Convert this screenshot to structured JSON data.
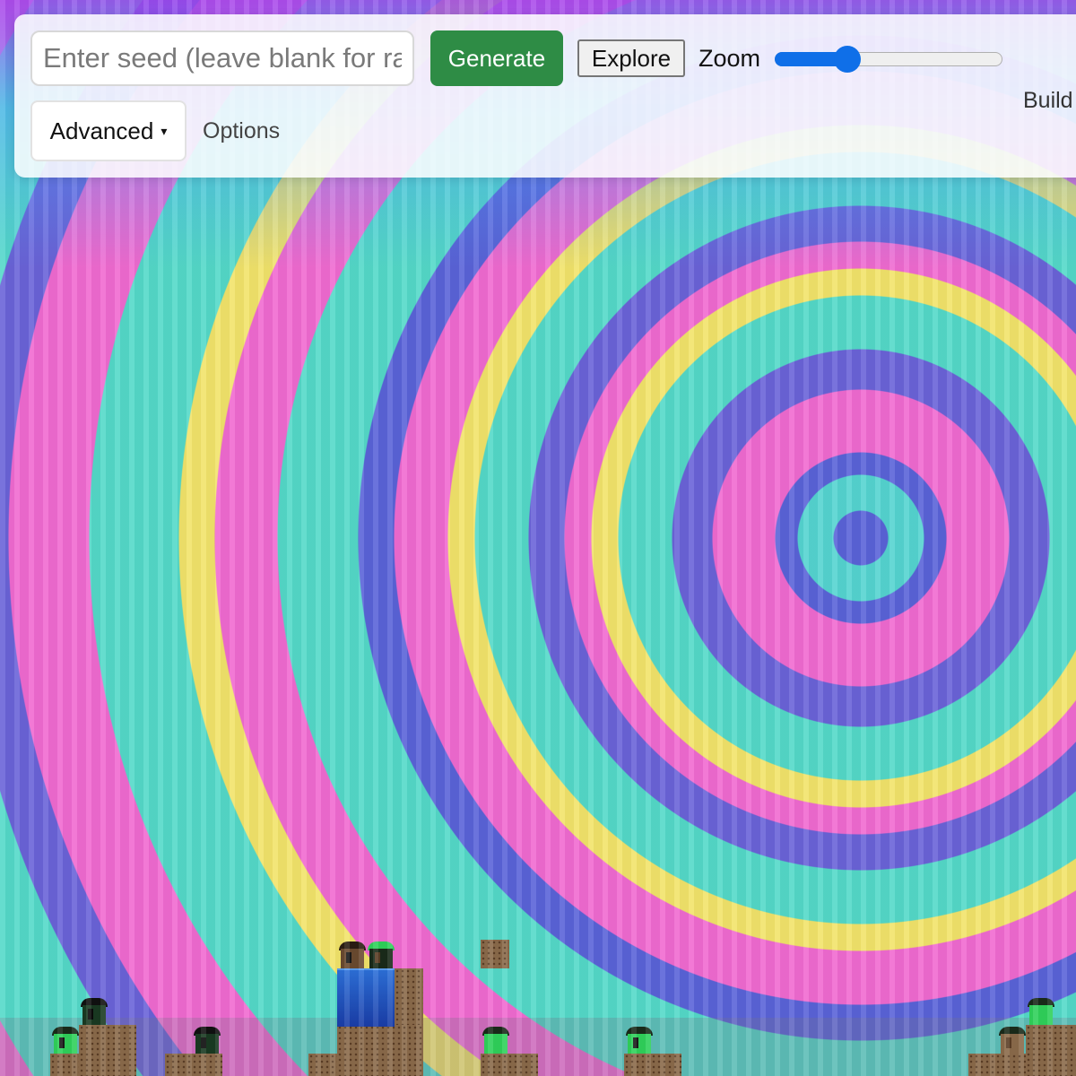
{
  "toolbar": {
    "seed_placeholder": "Enter seed (leave blank for ra",
    "seed_value": "",
    "generate_label": "Generate",
    "explore_label": "Explore",
    "zoom_label": "Zoom",
    "zoom_level": 0.32,
    "build_label": "Build",
    "advanced_label": "Advanced",
    "advanced_caret": "▾",
    "options_label": "Options"
  },
  "colors": {
    "generate_button": "#2e8c45",
    "slider_accent": "#0f6fe8",
    "dirt": "#8a6a4a",
    "water": "#1a3da8",
    "creature_green": "#2fd05a",
    "creature_dark": "#1a2a1a"
  }
}
